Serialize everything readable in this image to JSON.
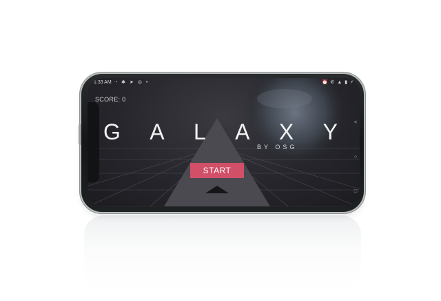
{
  "status_bar": {
    "time": "1:33 AM",
    "left_icons": "◔ ✱ ➤ ◎ •",
    "right_icons": "⏰ ✆ ▲ ▮ ⚡"
  },
  "game": {
    "score_label": "SCORE: 0",
    "title_letters": [
      "G",
      "A",
      "L",
      "A",
      "X",
      "Y"
    ],
    "subtitle": "BY OSG",
    "start_label": "START"
  },
  "nav_keys": [
    "<",
    "○",
    "□"
  ],
  "colors": {
    "start_button": "#d24f68",
    "triangle": "#4a4a50",
    "background": "#26262c"
  }
}
